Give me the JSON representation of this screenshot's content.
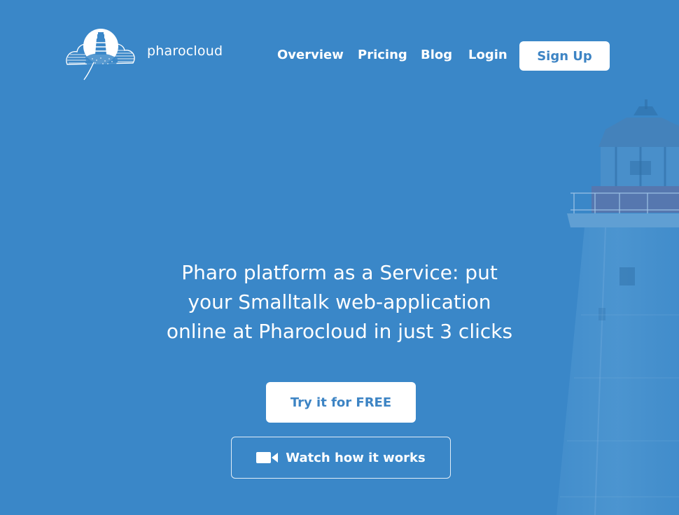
{
  "brand": {
    "name": "pharocloud",
    "logo_icon": "lighthouse-cloud-icon"
  },
  "nav": {
    "items": [
      {
        "label": "Overview"
      },
      {
        "label": "Pricing"
      },
      {
        "label": "Blog"
      },
      {
        "label": "Login"
      }
    ],
    "signup_label": "Sign Up"
  },
  "hero": {
    "headline_lines": [
      "Pharo platform as a Service: put",
      "your Smalltalk web-application",
      "online at Pharocloud in just 3 clicks"
    ],
    "cta_primary": "Try it for FREE",
    "cta_secondary": "Watch how it works",
    "cta_secondary_icon": "video-camera-icon"
  },
  "colors": {
    "background": "#3a87c8",
    "button_text": "#3d84c4",
    "text": "#ffffff"
  }
}
